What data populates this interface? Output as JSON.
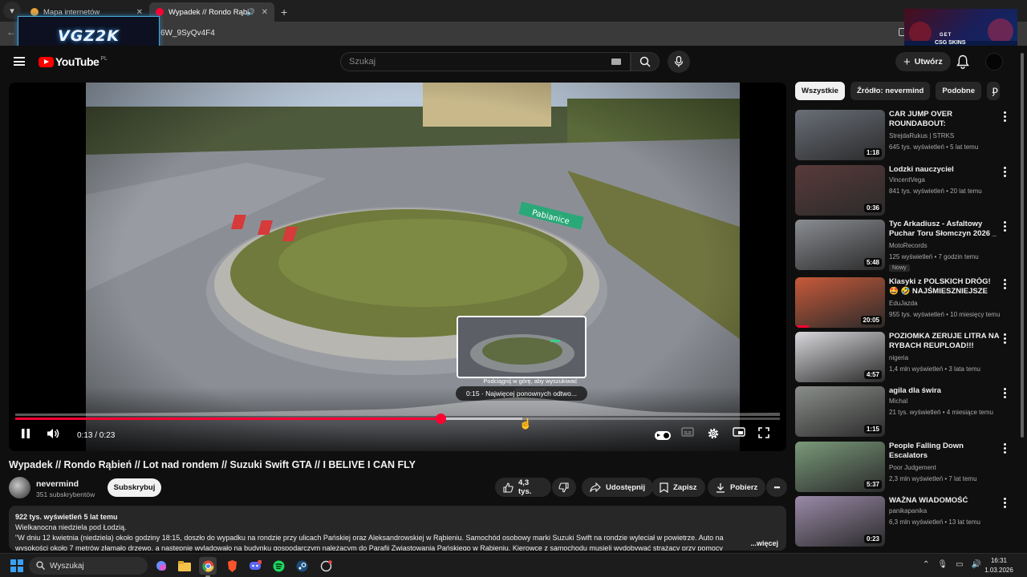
{
  "browser": {
    "tabs": [
      {
        "title": "Mapa internetów",
        "active": false
      },
      {
        "title": "Wypadek // Rondo Rąbień",
        "active": true
      }
    ],
    "url_fragment": "6W_9SyQv4F4"
  },
  "overlays": {
    "stream_logo": "VGZ2K",
    "ad_get": "GET",
    "ad_brand": "CSG SKINS"
  },
  "header": {
    "search_placeholder": "Szukaj",
    "create_label": "Utwórz"
  },
  "player": {
    "seek_hint": "Podciągnij w górę, aby wyszukiwać precyzyjnie",
    "preview_label": "0:15 · Najwięcej ponownych odtwo...",
    "time_display": "0:13 / 0:23",
    "progress": 0.557,
    "hover_position": 0.663
  },
  "video": {
    "title": "Wypadek // Rondo Rąbień // Lot nad rondem // Suzuki Swift GTA // I BELIVE I CAN FLY",
    "channel": "nevermind",
    "subscribers": "351 subskrybentów",
    "subscribe_label": "Subskrybuj",
    "likes": "4,3 tys.",
    "share_label": "Udostępnij",
    "save_label": "Zapisz",
    "download_label": "Pobierz",
    "description": {
      "stats": "922 tys. wyświetleń  5 lat temu",
      "line1": "Wielkanocna niedziela pod Łodzią.",
      "line2": "\"W dniu 12 kwietnia (niedziela) około godziny 18:15, doszło do wypadku na rondzie przy ulicach Pańskiej oraz Aleksandrowskiej w Rąbieniu. Samochód osobowy marki Suzuki Swift na rondzie wyleciał w powietrze. Auto na",
      "line3": "wysokości około 7 metrów złamało drzewo, a następnie wylądowało na budynku gospodarczym należącym do Parafii Zwiastowania Pańskiego w Rąbieniu. Kierowcę z samochodu musieli wydobywać strażacy przy pomocy",
      "more": "...więcej"
    }
  },
  "sidebar": {
    "chips": [
      "Wszystkie",
      "Źródło: nevermind",
      "Podobne",
      "D"
    ],
    "recommendations": [
      {
        "title": "CAR JUMP OVER ROUNDABOUT: UNBELIEVABL...",
        "channel": "StrejdaRukus | STRKS",
        "stats": "645 tys. wyświetleń • 5 lat temu",
        "duration": "1:18",
        "thumb": "#6a6f78",
        "watched": 0
      },
      {
        "title": "Lodzki nauczyciel",
        "channel": "VincentVega",
        "stats": "841 tys. wyświetleń • 20 lat temu",
        "duration": "0:36",
        "thumb": "#5a3a3a",
        "watched": 0
      },
      {
        "title": "Tyc Arkadiusz - Asfaltowy Puchar Toru Słomczyn 2026 _ ...",
        "channel": "MotoRecords",
        "stats": "125 wyświetleń • 7 godzin temu",
        "badge": "Nowy",
        "duration": "5:48",
        "thumb": "#8a8d92",
        "watched": 0
      },
      {
        "title": "Klasyki z POLSKICH DRÓG! 🤩 🤣 NAJŚMIESZNIEJSZE Wpadk...",
        "channel": "EduJazda",
        "stats": "955 tys. wyświetleń • 10 miesięcy temu",
        "duration": "20:05",
        "thumb": "#c85a3a",
        "watched": 0.15
      },
      {
        "title": "POZIOMKA ZERUJE LITRA NA RYBACH REUPLOAD!!!",
        "channel": "nigeria",
        "stats": "1,4 mln wyświetleń • 3 lata temu",
        "duration": "4:57",
        "thumb": "#d8d8dc",
        "watched": 0
      },
      {
        "title": "agila dla świra",
        "channel": "Michal",
        "stats": "21 tys. wyświetleń • 4 miesiące temu",
        "duration": "1:15",
        "thumb": "#8a8e8a",
        "watched": 0
      },
      {
        "title": "People Falling Down Escalators",
        "channel": "Poor Judgement",
        "stats": "2,3 mln wyświetleń • 7 lat temu",
        "duration": "5:37",
        "thumb": "#7a9a7a",
        "watched": 0
      },
      {
        "title": "WAŻNA WIADOMOŚĆ",
        "channel": "panikapanika",
        "stats": "6,3 mln wyświetleń • 13 lat temu",
        "duration": "0:23",
        "thumb": "#9a8aa8",
        "watched": 0
      }
    ]
  },
  "taskbar": {
    "search_label": "Wyszukaj",
    "time": "16:31",
    "date": "1.03.2026"
  },
  "colors": {
    "accent": "#ff0033",
    "background": "#0f0f0f",
    "surface": "#272727"
  }
}
